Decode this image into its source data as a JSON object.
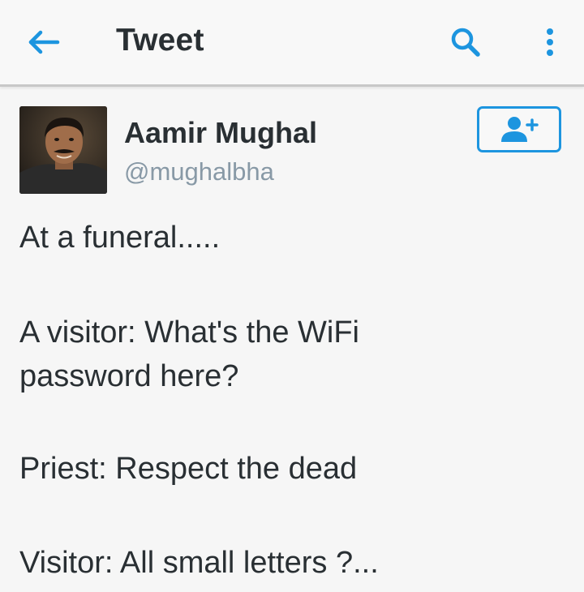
{
  "topbar": {
    "title": "Tweet",
    "back_icon": "arrow-left-icon",
    "search_icon": "search-icon",
    "overflow_icon": "more-vertical-icon",
    "accent_color": "#1d95df"
  },
  "tweet": {
    "author_name": "Aamir Mughal",
    "author_handle": "@mughalbha",
    "follow_icon": "follow-user-icon",
    "lines": [
      "At a funeral.....",
      "A visitor: What's the WiFi",
      "password here?",
      "Priest: Respect the dead",
      "Visitor: All small letters ?..."
    ]
  }
}
